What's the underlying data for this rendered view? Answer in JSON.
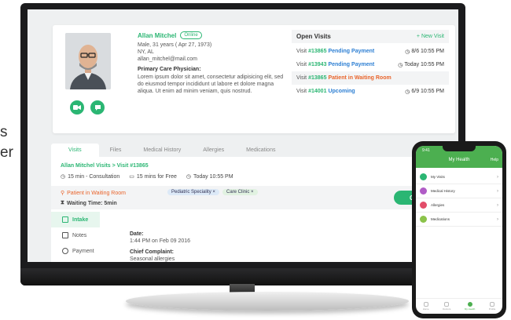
{
  "edge_text": {
    "fragment_s": "s",
    "fragment_er": "er"
  },
  "patient": {
    "name": "Allan Mitchel",
    "status": "Online",
    "details": [
      "Male, 31 years ( Apr 27, 1973)",
      "NY, AL",
      "allan_mitchel@mail.com"
    ],
    "physician_label": "Primary Care Physician:",
    "physician_text": "Lorem ipsum dolor sit amet, consectetur adipisicing elit, sed do eiusmod tempor incididunt ut labore et dolore magna aliqua. Ut enim ad minim veniam, quis nostrud."
  },
  "open_visits": {
    "title": "Open Visits",
    "new_label": "+ New Visit",
    "rows": [
      {
        "prefix": "Visit",
        "num": "#13865",
        "status": "Pending Payment",
        "status_color": "#2d7fd3",
        "time": "8/6 10:55 PM"
      },
      {
        "prefix": "Visit",
        "num": "#13943",
        "status": "Pending Payment",
        "status_color": "#2d7fd3",
        "time": "Today 10:55 PM"
      },
      {
        "prefix": "Visit",
        "num": "#13865",
        "status": "Patient in Waiting Room",
        "status_color": "#e9642b",
        "time": ""
      },
      {
        "prefix": "Visit",
        "num": "#14001",
        "status": "Upcoming",
        "status_color": "#2d7fd3",
        "time": "6/9 10:55 PM"
      }
    ]
  },
  "tabs": [
    "Visits",
    "Files",
    "Medical History",
    "Allergies",
    "Medications"
  ],
  "visit": {
    "breadcrumb": "Allan Mitchel Visits > Visit #13865",
    "consult": "15 min - Consultation",
    "free": "15 mins for Free",
    "time": "Today 10:55 PM",
    "status": "Patient in Waiting Room",
    "chip_specialty": "Pediatric Speciality ×",
    "chip_clinic": "Care Clinic ×",
    "waiting": "Waiting Time: 5min",
    "checkout": "Check Out"
  },
  "side_menu": [
    "Intake",
    "Notes",
    "Payment"
  ],
  "intake": {
    "date_label": "Date:",
    "date_value": "1:44 PM on Feb 09 2016",
    "complaint_label": "Chief Complaint:",
    "complaint_value": "Seasonal allergies"
  },
  "phone": {
    "clock": "9:41",
    "title": "My Health",
    "help": "Help",
    "items": [
      {
        "label": "My Visits",
        "color": "#2bb673"
      },
      {
        "label": "Medical History",
        "color": "#b05cc6"
      },
      {
        "label": "Allergies",
        "color": "#e24d6a"
      },
      {
        "label": "Medications",
        "color": "#8bc34a"
      }
    ],
    "nav": [
      "Home",
      "Doctors",
      "My Health",
      "Profile"
    ]
  },
  "colors": {
    "accent": "#2bb673",
    "link_blue": "#2d7fd3",
    "waiting_orange": "#e9642b"
  }
}
